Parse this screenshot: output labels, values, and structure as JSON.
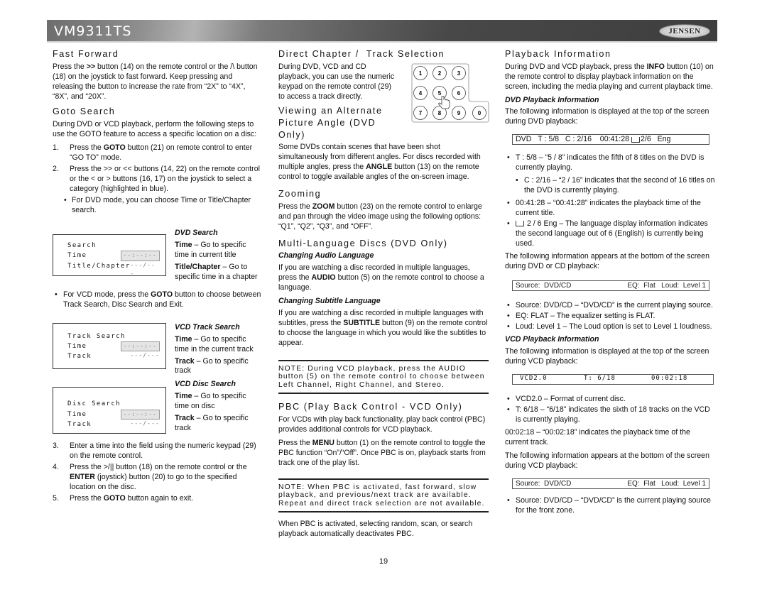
{
  "header": {
    "model": "VM9311TS",
    "brand_logo": "JENSEN"
  },
  "col1": {
    "fast_forward": {
      "title": "Fast Forward",
      "body": [
        "Press the ",
        ">>",
        " button (14) on the remote control or the /\\ button (18) on the joystick to fast forward. Keep pressing and releasing the button to increase the rate from “2X” to “4X”, “8X”, and “20X”."
      ]
    },
    "goto_search": {
      "title": "Goto Search",
      "intro": "During DVD or VCD playback, perform the following steps to use the GOTO feature to access a specific location on a disc:",
      "step1": {
        "num": "1.",
        "pre": "Press the ",
        "bold": "GOTO",
        "post": " button (21) on remote control to enter “GO TO” mode."
      },
      "step2": {
        "num": "2.",
        "text": "Press the >> or << buttons (14, 22) on the remote control or the < or > buttons (16, 17) on the joystick to select a category (highlighted in blue)."
      },
      "bullet_dvd": "For DVD mode, you can choose Time or Title/Chapter search.",
      "dvd_osd": {
        "title": "Search",
        "row1_label": "Time",
        "row1_value": "--:--:--",
        "row2_label": "Title/Chapter",
        "row2_value": "---/---"
      },
      "dvd_desc": {
        "heading": "DVD Search",
        "time_bold": "Time",
        "time_text": " – Go to specific time in current title",
        "tc_bold": "Title/Chapter",
        "tc_text": " – Go to specific time in a chapter"
      },
      "bullet_vcd": {
        "pre": "For VCD mode, press the ",
        "bold": "GOTO",
        "post": " button to choose between Track Search, Disc Search and Exit."
      },
      "track_osd": {
        "title": "Track Search",
        "row1_label": "Time",
        "row1_value": "--:--:--",
        "row2_label": "Track",
        "row2_value": "---/---"
      },
      "track_desc": {
        "heading": "VCD Track Search",
        "time_bold": "Time",
        "time_text": " – Go to specific time in the current track",
        "track_bold": "Track",
        "track_text": " – Go to specific track"
      },
      "disc_osd": {
        "title": "Disc Search",
        "row1_label": "Time",
        "row1_value": "--:--:--",
        "row2_label": "Track",
        "row2_value": "---/---"
      },
      "disc_desc": {
        "heading": "VCD Disc Search",
        "time_bold": "Time",
        "time_text": " – Go to specific time on disc",
        "track_bold": "Track",
        "track_text": " – Go to specific track"
      },
      "step3": {
        "num": "3.",
        "text": "Enter a time into the field using the numeric keypad (29) on the remote control."
      },
      "step4": {
        "num": "4.",
        "pre": "Press the >/|| button (18) on the remote control or the ",
        "bold": "ENTER",
        "post": " (joystick) button (20) to go to the specified location on the disc."
      },
      "step5": {
        "num": "5.",
        "pre": "Press the ",
        "bold": "GOTO",
        "post": " button again to exit."
      }
    }
  },
  "col2": {
    "direct": {
      "title": "Direct Chapter /  Track Selection",
      "body": "During DVD, VCD and CD playback, you can use the numeric keypad on the remote control (29) to access a track directly."
    },
    "keypad": {
      "keys": [
        "1",
        "2",
        "3",
        "4",
        "5",
        "6",
        "7",
        "8",
        "9",
        "0"
      ],
      "pointer": "hand-pointer-icon"
    },
    "angle": {
      "title": "Viewing an Alternate Picture Angle (DVD Only)",
      "pre": "Some DVDs contain scenes that have been shot simultaneously from different angles. For discs recorded with multiple angles, press the ",
      "bold": "ANGLE",
      "post": " button (13) on the remote control to toggle available angles of the on-screen image."
    },
    "zooming": {
      "title": "Zooming",
      "pre": "Press the ",
      "bold": "ZOOM",
      "post": " button (23) on the remote control to enlarge and pan through the video image using the following options: “Q1”, “Q2”, “Q3”, and “OFF”."
    },
    "multilang": {
      "title": "Multi-Language Discs (DVD Only)",
      "audio_heading": "Changing Audio Language",
      "audio_pre": "If you are watching a disc recorded in multiple languages, press the ",
      "audio_bold": "AUDIO",
      "audio_post": " button (5) on the remote control to choose a language.",
      "subtitle_heading": "Changing Subtitle Language",
      "subtitle_pre": "If you are watching a disc recorded in multiple languages with subtitles, press the ",
      "subtitle_bold": "SUBTITLE",
      "subtitle_post": " button (9) on the remote control to choose the language in which you would like the subtitles to appear."
    },
    "note1": "NOTE: During VCD playback, press the AUDIO button (5) on the remote control to choose between Left Channel, Right Channel, and Stereo.",
    "pbc": {
      "title": "PBC (Play Back Control - VCD Only)",
      "p1": "For VCDs with play back functionality, play back control (PBC) provides additional controls for VCD playback.",
      "p2_pre": "Press the ",
      "p2_bold": "MENU",
      "p2_post": " button (1) on the remote control to toggle the PBC function “On”/“Off”. Once PBC is on, playback starts from track one of the play list."
    },
    "note2": "NOTE: When PBC is activated, fast forward, slow playback, and previous/next track are available. Repeat and direct track selection are not available.",
    "pbc_after": "When PBC is activated, selecting random, scan, or search playback automatically deactivates PBC."
  },
  "col3": {
    "title": "Playback Information",
    "intro_pre": "During DVD and VCD playback, press the ",
    "intro_bold": "INFO",
    "intro_post": " button (10) on the remote control to display playback information on the screen, including the media playing and current playback time.",
    "dvd_heading": "DVD Playback Information",
    "dvd_top_text": "The following information is displayed at the top of the screen during DVD playback:",
    "dvd_bar": {
      "media": "DVD",
      "title": "T : 5/8",
      "chapter": "C : 2/16",
      "time": "00:41:28",
      "lang": "2/6",
      "lang_name": "Eng"
    },
    "dvd_bullets": {
      "t": "T : 5/8 – “5 / 8” indicates the fifth of 8 titles on the DVD is currently playing.",
      "c": "C : 2/16 – “2 / 16” indicates that the second of 16 titles on the DVD is currently playing.",
      "time": "00:41:28 – “00:41:28” indicates the playback time of the current title.",
      "lang": "2 / 6 Eng – The language display information indicates the second language out of 6 (English) is currently being used."
    },
    "dvd_bottom_text": "The following information appears at the bottom of the screen during DVD or CD playback:",
    "source_bar": {
      "source": "Source:  DVD/CD",
      "eq_loud": "EQ:  Flat   Loud:  Level 1"
    },
    "source_bullets": {
      "source": "Source: DVD/CD – “DVD/CD” is the current playing source.",
      "eq": "EQ: FLAT – The equalizer setting is FLAT.",
      "loud": "Loud: Level 1 – The Loud option is set to Level 1 loudness."
    },
    "vcd_heading": "VCD Playback Information",
    "vcd_top_text": "The following information is displayed at the top of the screen during VCD playback:",
    "vcd_bar": {
      "format": "VCD2.0",
      "track": "T: 6/18",
      "time": "00:02:18"
    },
    "vcd_bullets": {
      "format": "VCD2.0 – Format of current disc.",
      "track": "T: 6/18 – “6/18” indicates the sixth of 18 tracks on the VCD is currently playing."
    },
    "vcd_time_text": "00:02:18 – “00:02:18” indicates the playback time of the current track.",
    "vcd_bottom_text": "The following information appears at the bottom of the screen during VCD playback:",
    "vcd_source_bar": {
      "source": "Source:  DVD/CD",
      "eq_loud": "EQ:  Flat   Loud:  Level 1"
    },
    "vcd_source_bullet": "Source: DVD/CD – “DVD/CD” is the current playing source for the front zone."
  },
  "footer": {
    "page_number": "19"
  }
}
